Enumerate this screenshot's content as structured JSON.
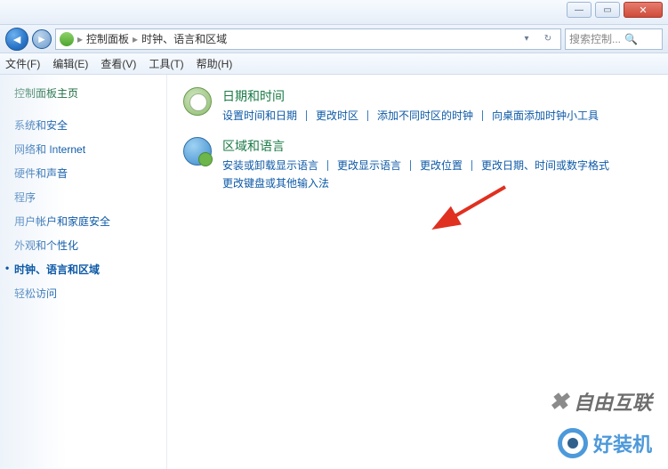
{
  "titlebar": {
    "min": "—",
    "max": "▭",
    "close": "✕"
  },
  "address": {
    "crumb1": "控制面板",
    "crumb2": "时钟、语言和区域",
    "sep": "▸",
    "dropdown": "▾",
    "refresh": "↻"
  },
  "search": {
    "placeholder": "搜索控制...",
    "icon": "🔍"
  },
  "menu": {
    "file": "文件(F)",
    "edit": "编辑(E)",
    "view": "查看(V)",
    "tools": "工具(T)",
    "help": "帮助(H)"
  },
  "sidebar": {
    "title": "控制面板主页",
    "items": [
      "系统和安全",
      "网络和 Internet",
      "硬件和声音",
      "程序",
      "用户帐户和家庭安全",
      "外观和个性化",
      "时钟、语言和区域",
      "轻松访问"
    ],
    "active_index": 6
  },
  "content": {
    "cat1": {
      "title": "日期和时间",
      "links": [
        "设置时间和日期",
        "更改时区",
        "添加不同时区的时钟",
        "向桌面添加时钟小工具"
      ]
    },
    "cat2": {
      "title": "区域和语言",
      "links_row1": [
        "安装或卸载显示语言",
        "更改显示语言",
        "更改位置",
        "更改日期、时间或数字格式"
      ],
      "links_row2": [
        "更改键盘或其他输入法"
      ]
    }
  },
  "watermarks": {
    "wm1": "自由互联",
    "wm2": "好装机"
  }
}
